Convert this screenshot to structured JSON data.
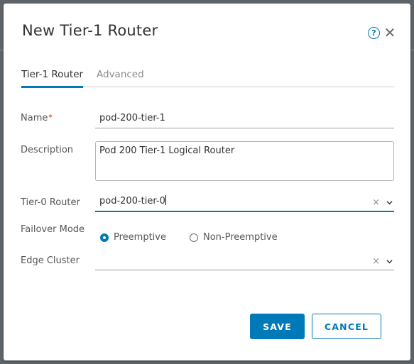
{
  "dialog": {
    "title": "New Tier-1 Router",
    "help_icon": "question-circle-icon",
    "help_glyph": "?",
    "close_icon": "close-icon",
    "close_glyph": "✕"
  },
  "tabs": [
    {
      "label": "Tier-1 Router",
      "active": true
    },
    {
      "label": "Advanced",
      "active": false
    }
  ],
  "form": {
    "name": {
      "label": "Name",
      "required_mark": "*",
      "value": "pod-200-tier-1"
    },
    "description": {
      "label": "Description",
      "value": "Pod 200 Tier-1 Logical Router"
    },
    "tier0_router": {
      "label": "Tier-0 Router",
      "value": "pod-200-tier-0",
      "clear_glyph": "×"
    },
    "failover_mode": {
      "label": "Failover Mode",
      "options": [
        {
          "label": "Preemptive",
          "selected": true
        },
        {
          "label": "Non-Preemptive",
          "selected": false
        }
      ]
    },
    "edge_cluster": {
      "label": "Edge Cluster",
      "value": "",
      "clear_glyph": "×"
    }
  },
  "buttons": {
    "save": "SAVE",
    "cancel": "CANCEL"
  },
  "colors": {
    "accent": "#0079b8",
    "required": "#c92100",
    "backdrop": "#5f6468"
  }
}
